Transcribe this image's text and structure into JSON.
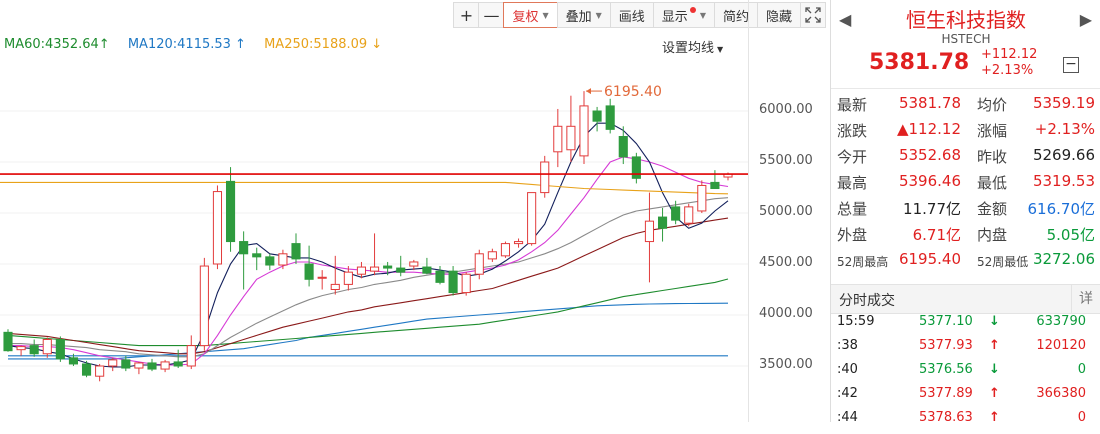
{
  "toolbar": {
    "plus": "+",
    "minus": "—",
    "adjust": "复权",
    "overlay": "叠加",
    "draw": "画线",
    "display": "显示",
    "compact": "简约",
    "hide": "隐藏",
    "fullscreen_icon": "fullscreen-icon"
  },
  "ma_legend": {
    "ma60": "MA60:4352.64",
    "ma60_arrow": "↑",
    "ma120": "MA120:4115.53",
    "ma120_arrow": "↑",
    "ma250": "MA250:5188.09",
    "ma250_arrow": "↓",
    "settings": "设置均线"
  },
  "chart_data": {
    "type": "candlestick",
    "y_ticks": [
      "6000.00",
      "5500.00",
      "5000.00",
      "4500.00",
      "4000.00",
      "3500.00"
    ],
    "y_tick_values": [
      6000,
      5500,
      5000,
      4500,
      4000,
      3500
    ],
    "ylim": [
      3200,
      6500
    ],
    "max_label": "6195.40",
    "max_value": 6195.4,
    "current_price": 5381.78,
    "colors": {
      "up": "#e23b3b",
      "down": "#2e9b3e",
      "ma5": "#13205c",
      "ma10": "#d63ad6",
      "ma20": "#8a8a8a",
      "ma30": "#8b1a1a",
      "ma60": "#1e8c2e",
      "ma120": "#1f78c4",
      "ma250": "#e8a21a",
      "ref": "#e00000"
    },
    "candles": [
      {
        "o": 3830,
        "h": 3860,
        "l": 3640,
        "c": 3650
      },
      {
        "o": 3660,
        "h": 3700,
        "l": 3600,
        "c": 3690
      },
      {
        "o": 3700,
        "h": 3760,
        "l": 3590,
        "c": 3620
      },
      {
        "o": 3620,
        "h": 3780,
        "l": 3580,
        "c": 3760
      },
      {
        "o": 3760,
        "h": 3790,
        "l": 3540,
        "c": 3570
      },
      {
        "o": 3580,
        "h": 3620,
        "l": 3500,
        "c": 3520
      },
      {
        "o": 3520,
        "h": 3550,
        "l": 3390,
        "c": 3410
      },
      {
        "o": 3400,
        "h": 3520,
        "l": 3350,
        "c": 3500
      },
      {
        "o": 3500,
        "h": 3580,
        "l": 3450,
        "c": 3560
      },
      {
        "o": 3560,
        "h": 3600,
        "l": 3450,
        "c": 3480
      },
      {
        "o": 3480,
        "h": 3540,
        "l": 3420,
        "c": 3530
      },
      {
        "o": 3530,
        "h": 3570,
        "l": 3450,
        "c": 3470
      },
      {
        "o": 3470,
        "h": 3560,
        "l": 3440,
        "c": 3540
      },
      {
        "o": 3540,
        "h": 3660,
        "l": 3480,
        "c": 3500
      },
      {
        "o": 3500,
        "h": 3800,
        "l": 3470,
        "c": 3700
      },
      {
        "o": 3700,
        "h": 4560,
        "l": 3650,
        "c": 4480
      },
      {
        "o": 4500,
        "h": 5270,
        "l": 4450,
        "c": 5210
      },
      {
        "o": 5310,
        "h": 5450,
        "l": 4620,
        "c": 4720
      },
      {
        "o": 4720,
        "h": 4820,
        "l": 4250,
        "c": 4600
      },
      {
        "o": 4600,
        "h": 4660,
        "l": 4440,
        "c": 4570
      },
      {
        "o": 4570,
        "h": 4600,
        "l": 4440,
        "c": 4490
      },
      {
        "o": 4490,
        "h": 4640,
        "l": 4450,
        "c": 4600
      },
      {
        "o": 4700,
        "h": 4800,
        "l": 4500,
        "c": 4550
      },
      {
        "o": 4500,
        "h": 4680,
        "l": 4280,
        "c": 4350
      },
      {
        "o": 4360,
        "h": 4440,
        "l": 4250,
        "c": 4370
      },
      {
        "o": 4250,
        "h": 4580,
        "l": 4200,
        "c": 4300
      },
      {
        "o": 4300,
        "h": 4480,
        "l": 4240,
        "c": 4420
      },
      {
        "o": 4400,
        "h": 4520,
        "l": 4360,
        "c": 4470
      },
      {
        "o": 4430,
        "h": 4800,
        "l": 4390,
        "c": 4470
      },
      {
        "o": 4480,
        "h": 4520,
        "l": 4390,
        "c": 4460
      },
      {
        "o": 4460,
        "h": 4580,
        "l": 4380,
        "c": 4420
      },
      {
        "o": 4480,
        "h": 4540,
        "l": 4440,
        "c": 4520
      },
      {
        "o": 4470,
        "h": 4560,
        "l": 4400,
        "c": 4410
      },
      {
        "o": 4430,
        "h": 4480,
        "l": 4300,
        "c": 4320
      },
      {
        "o": 4430,
        "h": 4480,
        "l": 4190,
        "c": 4220
      },
      {
        "o": 4220,
        "h": 4420,
        "l": 4190,
        "c": 4400
      },
      {
        "o": 4400,
        "h": 4640,
        "l": 4350,
        "c": 4600
      },
      {
        "o": 4550,
        "h": 4650,
        "l": 4520,
        "c": 4620
      },
      {
        "o": 4580,
        "h": 4720,
        "l": 4560,
        "c": 4700
      },
      {
        "o": 4700,
        "h": 4750,
        "l": 4660,
        "c": 4720
      },
      {
        "o": 4700,
        "h": 5200,
        "l": 4680,
        "c": 5200
      },
      {
        "o": 5200,
        "h": 5560,
        "l": 5150,
        "c": 5500
      },
      {
        "o": 5600,
        "h": 6020,
        "l": 5450,
        "c": 5850
      },
      {
        "o": 5620,
        "h": 6150,
        "l": 5500,
        "c": 5850
      },
      {
        "o": 5560,
        "h": 6195.4,
        "l": 5480,
        "c": 6050
      },
      {
        "o": 6000,
        "h": 6040,
        "l": 5800,
        "c": 5900
      },
      {
        "o": 6050,
        "h": 6120,
        "l": 5780,
        "c": 5820
      },
      {
        "o": 5750,
        "h": 5850,
        "l": 5480,
        "c": 5550
      },
      {
        "o": 5550,
        "h": 5590,
        "l": 5290,
        "c": 5340
      },
      {
        "o": 4720,
        "h": 5200,
        "l": 4320,
        "c": 4920
      },
      {
        "o": 4960,
        "h": 5050,
        "l": 4720,
        "c": 4850
      },
      {
        "o": 5060,
        "h": 5120,
        "l": 4890,
        "c": 4930
      },
      {
        "o": 4900,
        "h": 5090,
        "l": 4870,
        "c": 5060
      },
      {
        "o": 5020,
        "h": 5320,
        "l": 5000,
        "c": 5270
      },
      {
        "o": 5300,
        "h": 5420,
        "l": 5260,
        "c": 5240
      },
      {
        "o": 5352.68,
        "h": 5396.46,
        "l": 5319.53,
        "c": 5381.78
      }
    ],
    "ma5": [
      3700,
      3680,
      3670,
      3640,
      3620,
      3570,
      3530,
      3500,
      3490,
      3490,
      3510,
      3510,
      3510,
      3530,
      3560,
      3830,
      4220,
      4500,
      4680,
      4700,
      4600,
      4580,
      4560,
      4560,
      4520,
      4460,
      4410,
      4370,
      4400,
      4410,
      4440,
      4450,
      4460,
      4440,
      4420,
      4380,
      4400,
      4450,
      4530,
      4620,
      4730,
      4890,
      5200,
      5500,
      5750,
      5880,
      5880,
      5810,
      5680,
      5500,
      5200,
      4960,
      4850,
      4900,
      5020,
      5120
    ],
    "ma10": [
      3700,
      3700,
      3690,
      3690,
      3680,
      3660,
      3630,
      3600,
      3580,
      3560,
      3540,
      3520,
      3510,
      3510,
      3520,
      3620,
      3800,
      4000,
      4180,
      4350,
      4420,
      4480,
      4520,
      4520,
      4490,
      4470,
      4450,
      4440,
      4430,
      4420,
      4420,
      4420,
      4410,
      4400,
      4400,
      4420,
      4440,
      4460,
      4490,
      4540,
      4620,
      4710,
      4830,
      4990,
      5150,
      5330,
      5500,
      5550,
      5530,
      5500,
      5460,
      5400,
      5340,
      5300,
      5280,
      5260
    ],
    "ma20": [
      3720,
      3720,
      3710,
      3710,
      3700,
      3690,
      3680,
      3660,
      3650,
      3640,
      3620,
      3610,
      3600,
      3590,
      3590,
      3620,
      3700,
      3780,
      3850,
      3920,
      3980,
      4040,
      4100,
      4150,
      4190,
      4220,
      4250,
      4270,
      4300,
      4320,
      4340,
      4370,
      4390,
      4410,
      4420,
      4440,
      4460,
      4480,
      4500,
      4520,
      4560,
      4600,
      4650,
      4710,
      4780,
      4850,
      4920,
      4980,
      5020,
      5040,
      5060,
      5080,
      5100,
      5120,
      5140,
      5150
    ],
    "ma30": [
      3820,
      3810,
      3800,
      3790,
      3770,
      3750,
      3730,
      3710,
      3690,
      3670,
      3650,
      3640,
      3630,
      3620,
      3620,
      3640,
      3680,
      3720,
      3760,
      3800,
      3840,
      3880,
      3910,
      3940,
      3970,
      4000,
      4030,
      4050,
      4080,
      4100,
      4120,
      4140,
      4160,
      4180,
      4200,
      4220,
      4240,
      4260,
      4300,
      4340,
      4380,
      4420,
      4460,
      4520,
      4580,
      4640,
      4700,
      4760,
      4800,
      4830,
      4850,
      4870,
      4890,
      4910,
      4930,
      4950
    ],
    "ma60": [
      3800,
      3790,
      3780,
      3770,
      3760,
      3750,
      3740,
      3730,
      3720,
      3710,
      3700,
      3700,
      3700,
      3700,
      3700,
      3700,
      3710,
      3720,
      3730,
      3740,
      3750,
      3760,
      3770,
      3780,
      3790,
      3800,
      3810,
      3820,
      3830,
      3840,
      3850,
      3860,
      3870,
      3880,
      3890,
      3900,
      3910,
      3930,
      3950,
      3970,
      3990,
      4010,
      4030,
      4060,
      4090,
      4120,
      4150,
      4180,
      4200,
      4220,
      4240,
      4260,
      4280,
      4300,
      4320,
      4352.64
    ],
    "ma120": [
      3570,
      3570,
      3570,
      3570,
      3570,
      3570,
      3570,
      3570,
      3570,
      3580,
      3590,
      3600,
      3610,
      3620,
      3630,
      3640,
      3650,
      3660,
      3670,
      3690,
      3710,
      3730,
      3750,
      3780,
      3800,
      3820,
      3840,
      3860,
      3880,
      3900,
      3920,
      3940,
      3960,
      3970,
      3980,
      3990,
      4000,
      4010,
      4020,
      4030,
      4040,
      4050,
      4060,
      4070,
      4080,
      4090,
      4095,
      4100,
      4105,
      4108,
      4110,
      4112,
      4113,
      4114,
      4115,
      4115.53
    ],
    "ma250": [
      3600,
      3600,
      3600,
      3600,
      3600,
      3600,
      3600,
      3600,
      3600,
      3600,
      3600,
      3600,
      3600,
      3600,
      3600,
      3600,
      3600,
      3600,
      3600,
      3600,
      3600,
      3600,
      3600,
      3600,
      3600,
      3600,
      3600,
      3600,
      3600,
      3600,
      3600,
      3600,
      3600,
      3600,
      3600,
      3600,
      3600,
      3600,
      3600,
      3600,
      3600,
      3600,
      3600,
      3600,
      3600,
      3600,
      3600,
      3600,
      3600,
      3600,
      3600,
      3600,
      3600,
      3600,
      3600,
      3600
    ],
    "ma250_flat_section": [
      5300,
      5290,
      5280,
      5270,
      5260,
      5250,
      5240,
      5235,
      5230,
      5225,
      5220,
      5215,
      5210,
      5205,
      5200,
      5195,
      5190,
      5188.09
    ]
  },
  "sidebar": {
    "name": "恒生科技指数",
    "code": "HSTECH",
    "price": "5381.78",
    "change": "+112.12",
    "pct": "+2.13%",
    "quote": [
      {
        "l1": "最新",
        "v1": "5381.78",
        "c1": "red",
        "l2": "均价",
        "v2": "5359.19",
        "c2": "red"
      },
      {
        "l1": "涨跌",
        "v1": "▲112.12",
        "c1": "red",
        "l2": "涨幅",
        "v2": "+2.13%",
        "c2": "red"
      },
      {
        "l1": "今开",
        "v1": "5352.68",
        "c1": "red",
        "l2": "昨收",
        "v2": "5269.66",
        "c2": "dark"
      },
      {
        "l1": "最高",
        "v1": "5396.46",
        "c1": "red",
        "l2": "最低",
        "v2": "5319.53",
        "c2": "red"
      },
      {
        "l1": "总量",
        "v1": "11.77亿",
        "c1": "dark",
        "l2": "金额",
        "v2": "616.70亿",
        "c2": "blue"
      },
      {
        "l1": "外盘",
        "v1": "6.71亿",
        "c1": "red",
        "l2": "内盘",
        "v2": "5.05亿",
        "c2": "green"
      },
      {
        "l1": "52周最高",
        "v1": "6195.40",
        "c1": "red",
        "l2": "52周最低",
        "v2": "3272.06",
        "c2": "green",
        "small": true
      }
    ],
    "split_title": "分时成交",
    "detail": "详",
    "ticks": [
      {
        "t": "15:59",
        "p": "5377.10",
        "a": "↓",
        "ac": "green",
        "v": "633790",
        "vc": "green"
      },
      {
        "t": ":38",
        "p": "5377.93",
        "a": "↑",
        "ac": "red",
        "v": "120120",
        "vc": "red"
      },
      {
        "t": ":40",
        "p": "5376.56",
        "a": "↓",
        "ac": "green",
        "v": "0",
        "vc": "green"
      },
      {
        "t": ":42",
        "p": "5377.89",
        "a": "↑",
        "ac": "red",
        "v": "366380",
        "vc": "red"
      },
      {
        "t": ":44",
        "p": "5378.63",
        "a": "↑",
        "ac": "red",
        "v": "0",
        "vc": "red"
      }
    ]
  }
}
